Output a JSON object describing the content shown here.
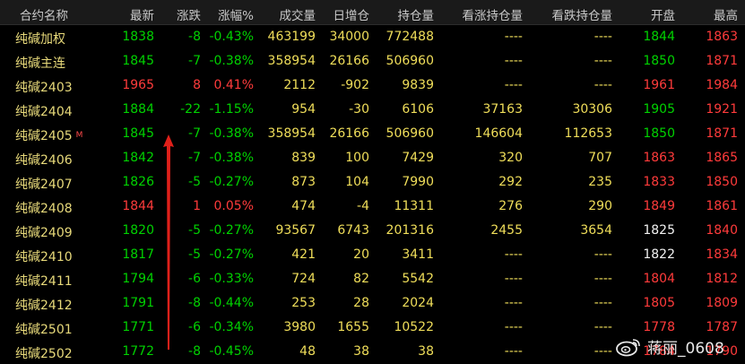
{
  "columns": [
    "合约名称",
    "最新",
    "涨跌",
    "涨幅%",
    "成交量",
    "日增仓",
    "持仓量",
    "看涨持仓量",
    "看跌持仓量",
    "开盘",
    "最高"
  ],
  "rows": [
    {
      "name": "纯碱加权",
      "mark": "",
      "last": "1838",
      "chg": "-8",
      "pct": "-0.43%",
      "vol": "463199",
      "oi_chg": "34000",
      "oi": "772488",
      "call_oi": "----",
      "put_oi": "----",
      "open": "1844",
      "high": "1863",
      "dir": "dn",
      "open_c": "dn",
      "high_c": "up"
    },
    {
      "name": "纯碱主连",
      "mark": "",
      "last": "1845",
      "chg": "-7",
      "pct": "-0.38%",
      "vol": "358954",
      "oi_chg": "26166",
      "oi": "506960",
      "call_oi": "----",
      "put_oi": "----",
      "open": "1850",
      "high": "1871",
      "dir": "dn",
      "open_c": "dn",
      "high_c": "up"
    },
    {
      "name": "纯碱2403",
      "mark": "",
      "last": "1965",
      "chg": "8",
      "pct": "0.41%",
      "vol": "2112",
      "oi_chg": "-902",
      "oi": "9839",
      "call_oi": "----",
      "put_oi": "----",
      "open": "1961",
      "high": "1984",
      "dir": "up",
      "open_c": "up",
      "high_c": "up"
    },
    {
      "name": "纯碱2404",
      "mark": "",
      "last": "1884",
      "chg": "-22",
      "pct": "-1.15%",
      "vol": "954",
      "oi_chg": "-30",
      "oi": "6106",
      "call_oi": "37163",
      "put_oi": "30306",
      "open": "1905",
      "high": "1921",
      "dir": "dn",
      "open_c": "dn",
      "high_c": "up"
    },
    {
      "name": "纯碱2405",
      "mark": "M",
      "last": "1845",
      "chg": "-7",
      "pct": "-0.38%",
      "vol": "358954",
      "oi_chg": "26166",
      "oi": "506960",
      "call_oi": "146604",
      "put_oi": "112653",
      "open": "1850",
      "high": "1871",
      "dir": "dn",
      "open_c": "dn",
      "high_c": "up"
    },
    {
      "name": "纯碱2406",
      "mark": "",
      "last": "1842",
      "chg": "-7",
      "pct": "-0.38%",
      "vol": "839",
      "oi_chg": "100",
      "oi": "7429",
      "call_oi": "320",
      "put_oi": "707",
      "open": "1863",
      "high": "1865",
      "dir": "dn",
      "open_c": "up",
      "high_c": "up"
    },
    {
      "name": "纯碱2407",
      "mark": "",
      "last": "1826",
      "chg": "-5",
      "pct": "-0.27%",
      "vol": "873",
      "oi_chg": "104",
      "oi": "7990",
      "call_oi": "292",
      "put_oi": "235",
      "open": "1833",
      "high": "1850",
      "dir": "dn",
      "open_c": "up",
      "high_c": "up"
    },
    {
      "name": "纯碱2408",
      "mark": "",
      "last": "1844",
      "chg": "1",
      "pct": "0.05%",
      "vol": "474",
      "oi_chg": "-4",
      "oi": "11311",
      "call_oi": "276",
      "put_oi": "290",
      "open": "1849",
      "high": "1861",
      "dir": "up",
      "open_c": "up",
      "high_c": "up"
    },
    {
      "name": "纯碱2409",
      "mark": "",
      "last": "1820",
      "chg": "-5",
      "pct": "-0.27%",
      "vol": "93567",
      "oi_chg": "6743",
      "oi": "201316",
      "call_oi": "2455",
      "put_oi": "3654",
      "open": "1825",
      "high": "1840",
      "dir": "dn",
      "open_c": "wh",
      "high_c": "up"
    },
    {
      "name": "纯碱2410",
      "mark": "",
      "last": "1817",
      "chg": "-5",
      "pct": "-0.27%",
      "vol": "421",
      "oi_chg": "20",
      "oi": "3411",
      "call_oi": "----",
      "put_oi": "----",
      "open": "1822",
      "high": "1834",
      "dir": "dn",
      "open_c": "wh",
      "high_c": "up"
    },
    {
      "name": "纯碱2411",
      "mark": "",
      "last": "1794",
      "chg": "-6",
      "pct": "-0.33%",
      "vol": "724",
      "oi_chg": "82",
      "oi": "5542",
      "call_oi": "----",
      "put_oi": "----",
      "open": "1804",
      "high": "1812",
      "dir": "dn",
      "open_c": "up",
      "high_c": "up"
    },
    {
      "name": "纯碱2412",
      "mark": "",
      "last": "1791",
      "chg": "-8",
      "pct": "-0.44%",
      "vol": "253",
      "oi_chg": "28",
      "oi": "2024",
      "call_oi": "----",
      "put_oi": "----",
      "open": "1805",
      "high": "1809",
      "dir": "dn",
      "open_c": "up",
      "high_c": "up"
    },
    {
      "name": "纯碱2501",
      "mark": "",
      "last": "1771",
      "chg": "-6",
      "pct": "-0.34%",
      "vol": "3980",
      "oi_chg": "1655",
      "oi": "10522",
      "call_oi": "----",
      "put_oi": "----",
      "open": "1778",
      "high": "1787",
      "dir": "dn",
      "open_c": "up",
      "high_c": "up"
    },
    {
      "name": "纯碱2502",
      "mark": "",
      "last": "1772",
      "chg": "-8",
      "pct": "-0.45%",
      "vol": "48",
      "oi_chg": "38",
      "oi": "38",
      "call_oi": "----",
      "put_oi": "----",
      "open": "1784",
      "high": "1790",
      "dir": "dn",
      "open_c": "up",
      "high_c": "up"
    }
  ],
  "watermark": {
    "text": "蒋丽_0608",
    "icon": "weibo-icon"
  },
  "colors": {
    "up": "#ff3b3b",
    "down": "#00d200",
    "name": "#e7d97a",
    "neutral": "#f0de5a",
    "arrow": "#e0201a"
  }
}
